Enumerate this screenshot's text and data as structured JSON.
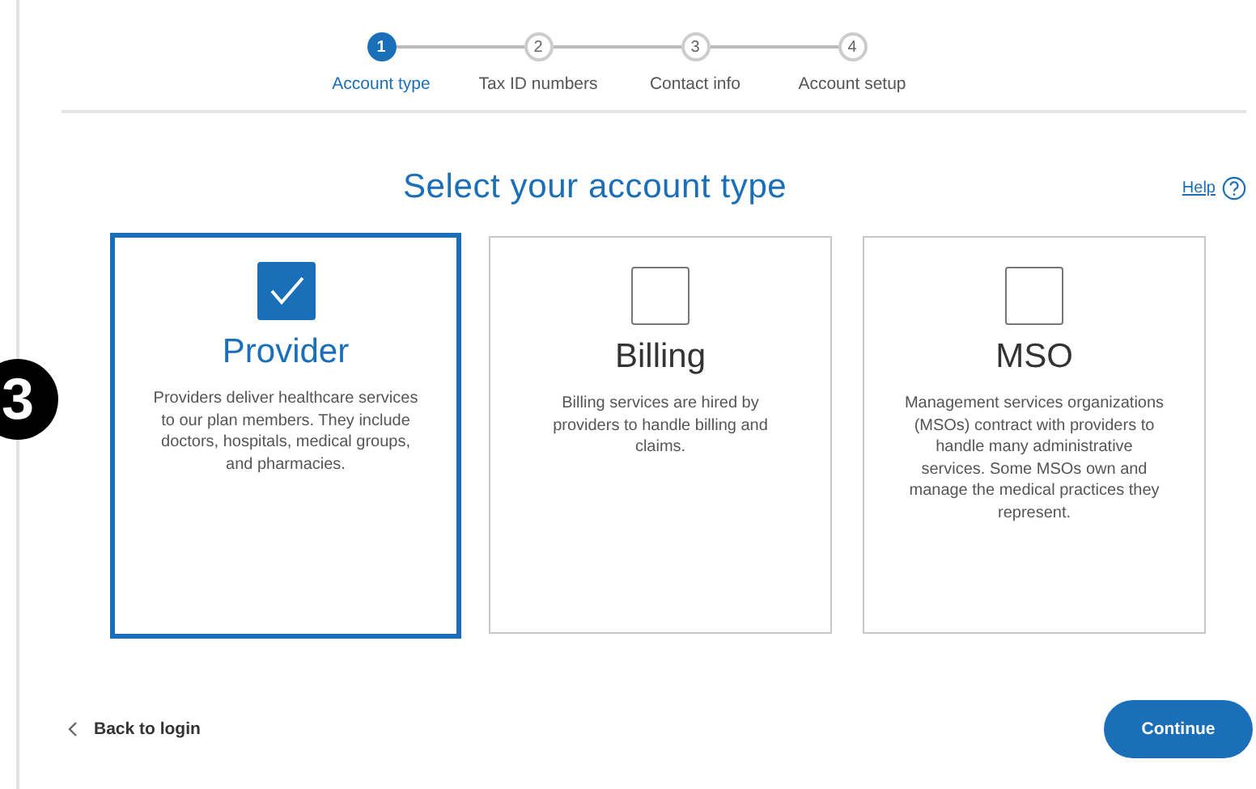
{
  "callout": "3",
  "steps": [
    {
      "number": "1",
      "label": "Account type",
      "selected": true
    },
    {
      "number": "2",
      "label": "Tax ID numbers",
      "selected": false
    },
    {
      "number": "3",
      "label": "Contact info",
      "selected": false
    },
    {
      "number": "4",
      "label": "Account setup",
      "selected": false
    }
  ],
  "title": "Select your account type",
  "help": "Help",
  "account_types": [
    {
      "name": "Provider",
      "description": "Providers deliver healthcare services to our plan members. They include doctors, hospitals, medical groups, and pharmacies.",
      "selected": true
    },
    {
      "name": "Billing",
      "description": "Billing services are hired by providers to handle billing and claims.",
      "selected": false
    },
    {
      "name": "MSO",
      "description": "Management services organizations (MSOs) contract with providers to handle many administrative services. Some MSOs own and manage the medical practices they represent.",
      "selected": false
    }
  ],
  "back_link": "Back to login",
  "continue_button": "Continue"
}
